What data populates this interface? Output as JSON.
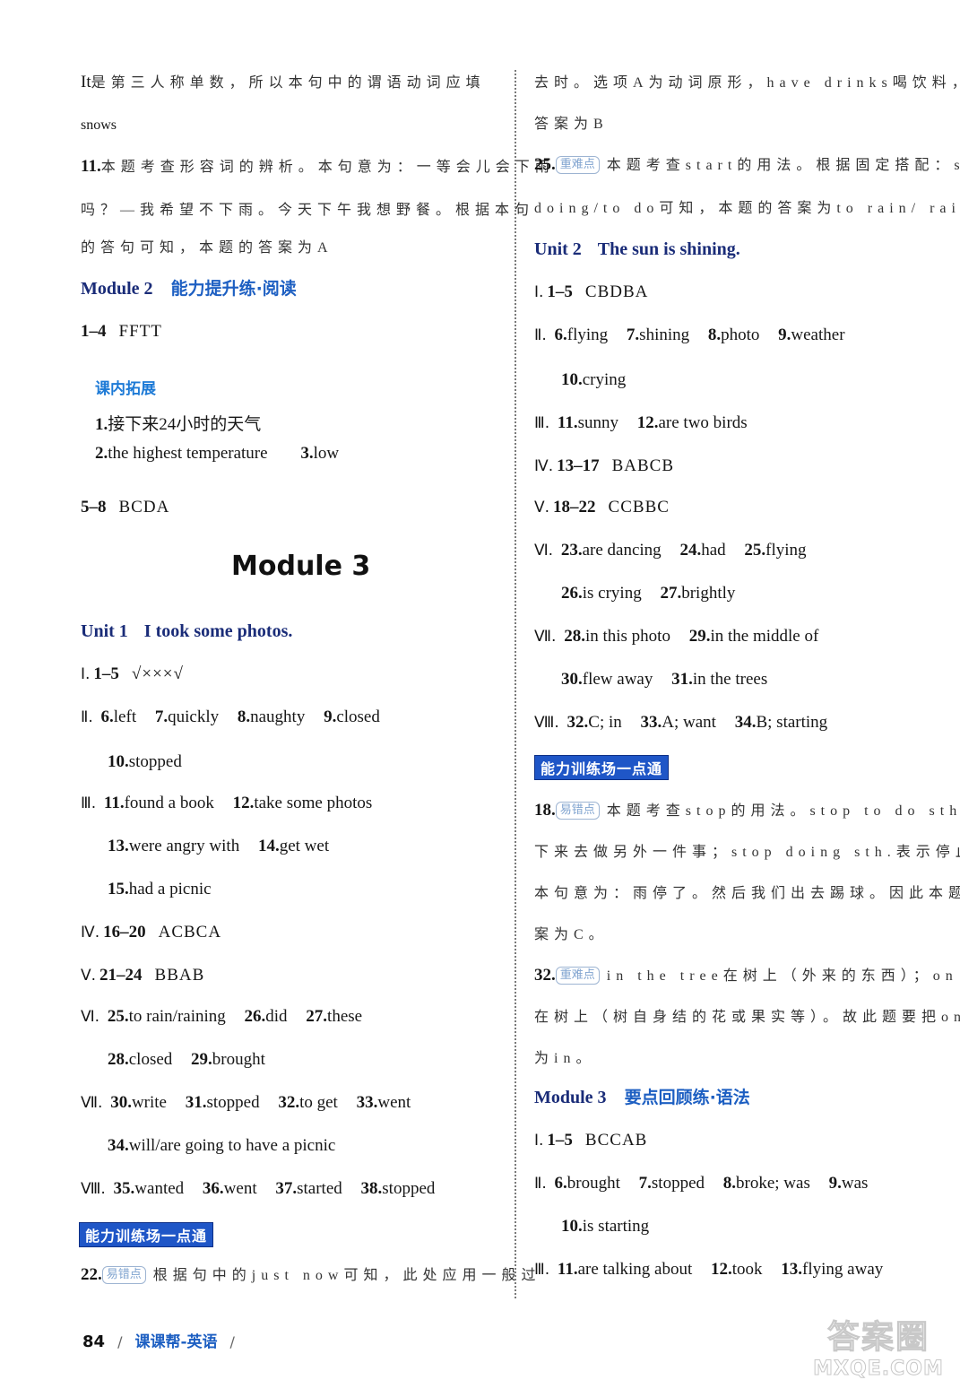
{
  "left": {
    "intro_line1": {
      "en": "It",
      "cn": "是第三人称单数，所以本句中的谓语动词应填"
    },
    "intro_line2": "snows",
    "q11": {
      "num": "11.",
      "l1": "本题考查形容词的辨析。本句意为：一等会儿会下雨",
      "l2": "吗？—我希望不下雨。今天下午我想野餐。根据本句",
      "l3": "的答句可知，本题的答案为A"
    },
    "module2_heading": {
      "en": "Module 2",
      "cn": "能力提升练·阅读"
    },
    "m2_row1": {
      "range": "1–4",
      "answers": "FFTT"
    },
    "extension": {
      "title": "课内拓展",
      "item1": {
        "num": "1.",
        "text": "接下来24小时的天气"
      },
      "item2": {
        "num": "2.",
        "text": "the highest temperature"
      },
      "item3": {
        "num": "3.",
        "text": "low"
      }
    },
    "m2_row2": {
      "range": "5–8",
      "answers": "BCDA"
    },
    "module3_title": "Module 3",
    "unit1": {
      "label": "Unit 1",
      "title": "I took some photos.",
      "s1": {
        "roman": "Ⅰ.",
        "range": "1–5",
        "answers": "√×××√"
      },
      "s2": {
        "roman": "Ⅱ.",
        "items": [
          "6.",
          "left",
          "7.",
          "quickly",
          "8.",
          "naughty",
          "9.",
          "closed"
        ],
        "cont": [
          "10.",
          "stopped"
        ]
      },
      "s3": {
        "roman": "Ⅲ.",
        "items": [
          "11.",
          "found a book",
          "12.",
          "take some photos"
        ],
        "cont1": [
          "13.",
          "were angry with",
          "14.",
          "get wet"
        ],
        "cont2": [
          "15.",
          "had a picnic"
        ]
      },
      "s4": {
        "roman": "Ⅳ.",
        "range": "16–20",
        "answers": "ACBCA"
      },
      "s5": {
        "roman": "Ⅴ.",
        "range": "21–24",
        "answers": "BBAB"
      },
      "s6": {
        "roman": "Ⅵ.",
        "items": [
          "25.",
          "to rain/raining",
          "26.",
          "did",
          "27.",
          "these"
        ],
        "cont": [
          "28.",
          "closed",
          "29.",
          "brought"
        ]
      },
      "s7": {
        "roman": "Ⅶ.",
        "items": [
          "30.",
          "write",
          "31.",
          "stopped",
          "32.",
          "to get",
          "33.",
          "went"
        ],
        "cont": [
          "34.",
          "will/are going to have a picnic"
        ]
      },
      "s8": {
        "roman": "Ⅷ.",
        "items": [
          "35.",
          "wanted",
          "36.",
          "went",
          "37.",
          "started",
          "38.",
          "stopped"
        ]
      }
    },
    "banner": "能力训练场一点通",
    "note22": {
      "num": "22.",
      "tag": "易错点",
      "text": "根据句中的just now可知，此处应用一般过"
    }
  },
  "right": {
    "cont1": "去时。选项A为动词原形，have drinks喝饮料，所以本题",
    "cont2": "答案为B",
    "note25": {
      "num": "25.",
      "tag": "重难点",
      "l1": "本题考查start的用法。根据固定搭配：start",
      "l2": "doing/to do可知，本题的答案为to rain/ raining"
    },
    "unit2": {
      "label": "Unit 2",
      "title": "The sun is shining.",
      "s1": {
        "roman": "Ⅰ.",
        "range": "1–5",
        "answers": "CBDBA"
      },
      "s2": {
        "roman": "Ⅱ.",
        "items": [
          "6.",
          "flying",
          "7.",
          "shining",
          "8.",
          "photo",
          "9.",
          "weather"
        ],
        "cont": [
          "10.",
          "crying"
        ]
      },
      "s3": {
        "roman": "Ⅲ.",
        "items": [
          "11.",
          "sunny",
          "12.",
          "are two birds"
        ]
      },
      "s4": {
        "roman": "Ⅳ.",
        "range": "13–17",
        "answers": "BABCB"
      },
      "s5": {
        "roman": "Ⅴ.",
        "range": "18–22",
        "answers": "CCBBC"
      },
      "s6": {
        "roman": "Ⅵ.",
        "items": [
          "23.",
          "are dancing",
          "24.",
          "had",
          "25.",
          "flying"
        ],
        "cont": [
          "26.",
          "is crying",
          "27.",
          "brightly"
        ]
      },
      "s7": {
        "roman": "Ⅶ.",
        "items": [
          "28.",
          "in this photo",
          "29.",
          "in the middle of"
        ],
        "cont": [
          "30.",
          "flew away",
          "31.",
          "in the trees"
        ]
      },
      "s8": {
        "roman": "Ⅷ.",
        "items": [
          "32.",
          "C; in",
          "33.",
          "A; want",
          "34.",
          "B; starting"
        ]
      }
    },
    "banner": "能力训练场一点通",
    "note18": {
      "num": "18.",
      "tag": "易错点",
      "l1": "本题考查stop的用法。stop to do sth.表示停",
      "l2": "下来去做另外一件事；stop doing sth.表示停止做某事。",
      "l3": "本句意为：雨停了。然后我们出去踢球。因此本题答",
      "l4": "案为C。"
    },
    "note32": {
      "num": "32.",
      "tag": "重难点",
      "l1": "in the tree在树上（外来的东西）；on the tree",
      "l2": "在树上（树自身结的花或果实等）。故此题要把on改",
      "l3": "为in。"
    },
    "module3_heading": {
      "en": "Module 3",
      "cn": "要点回顾练·语法"
    },
    "g1": {
      "roman": "Ⅰ.",
      "range": "1–5",
      "answers": "BCCAB"
    },
    "g2": {
      "roman": "Ⅱ.",
      "items": [
        "6.",
        "brought",
        "7.",
        "stopped",
        "8.",
        "broke; was",
        "9.",
        "was"
      ],
      "cont": [
        "10.",
        "is starting"
      ]
    },
    "g3": {
      "roman": "Ⅲ.",
      "items": [
        "11.",
        "are talking about",
        "12.",
        "took",
        "13.",
        "flying away"
      ]
    }
  },
  "footer": {
    "page_number": "84",
    "book_title": "课课帮-英语"
  },
  "watermark": {
    "cn": "答案圈",
    "en": "MXQE.COM"
  },
  "colors": {
    "heading_navy": "#1a2c78",
    "heading_blue": "#1d5fc2",
    "banner_bg": "#1f56c7",
    "extension_blue": "#1d7ad6"
  }
}
